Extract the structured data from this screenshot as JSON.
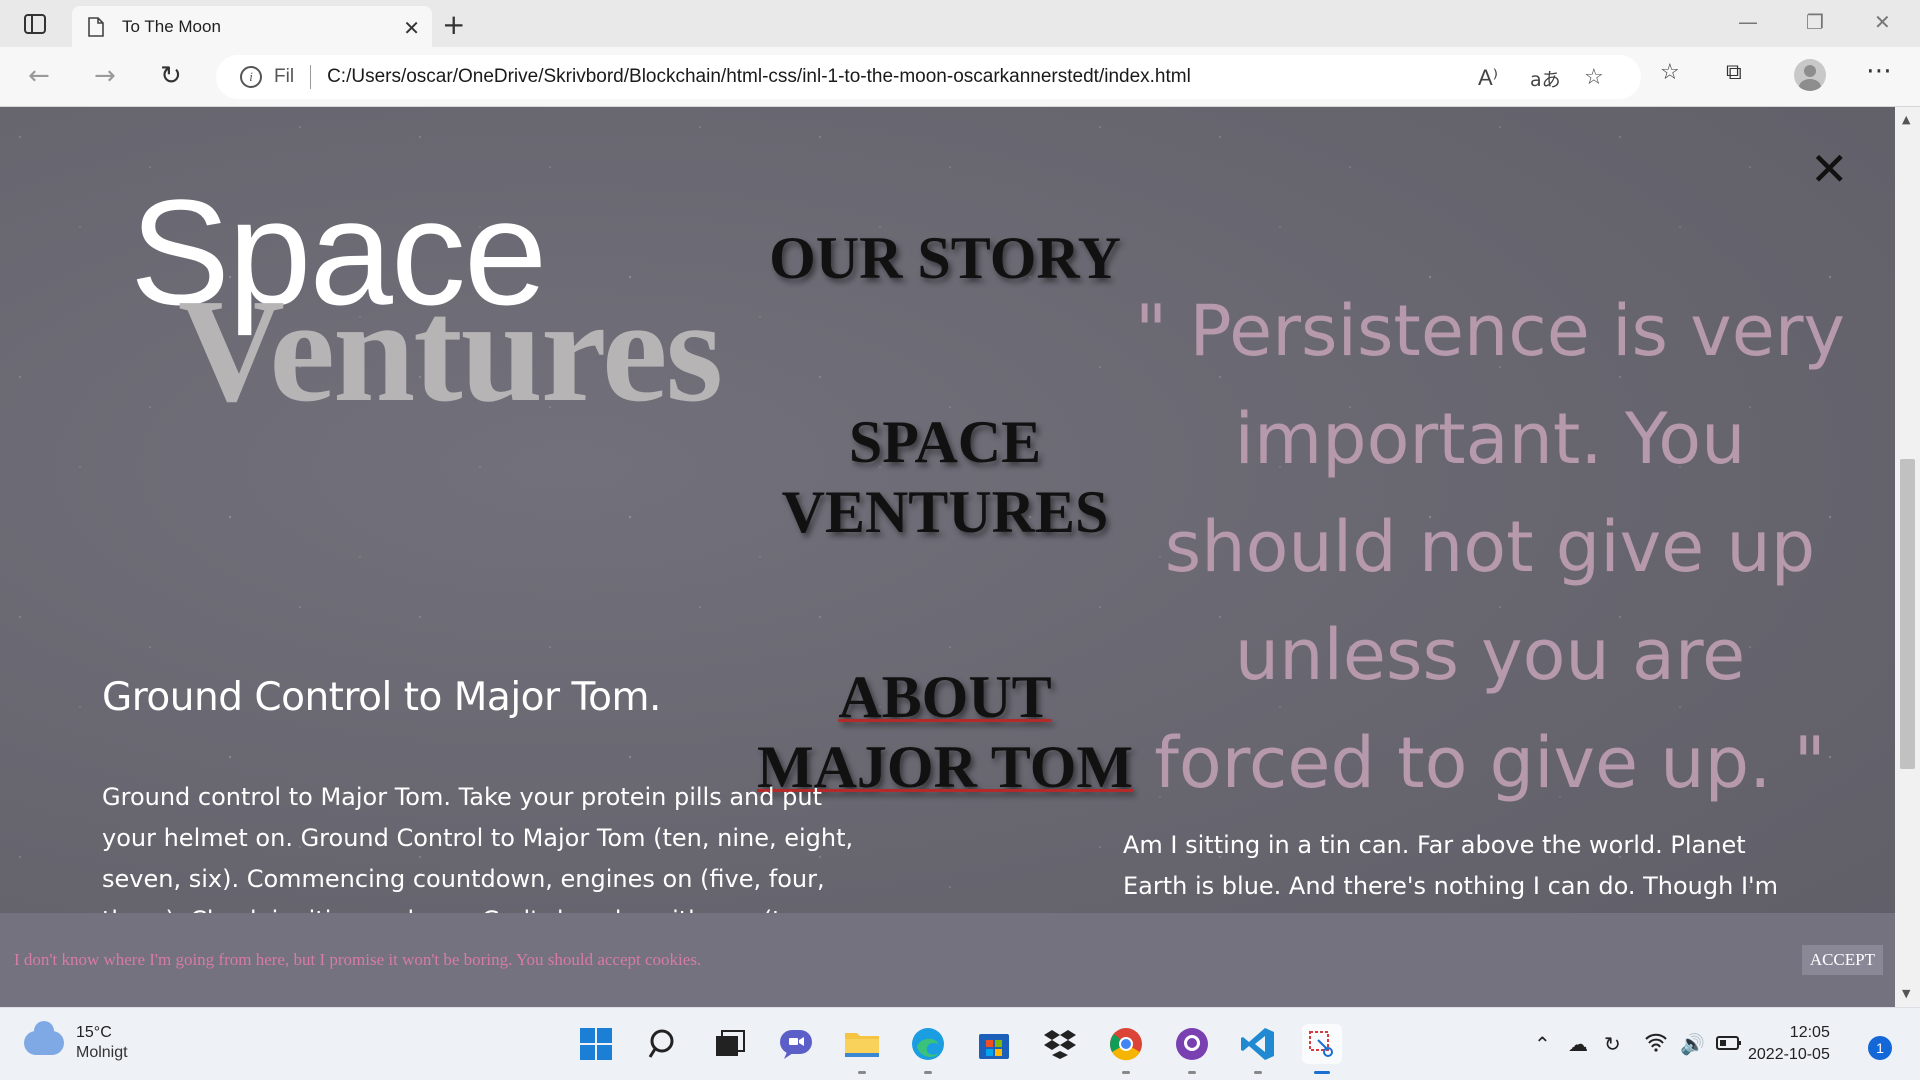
{
  "browser": {
    "tab_title": "To The Moon",
    "tab_close": "✕",
    "new_tab": "+",
    "url_scheme": "Fil",
    "url": "C:/Users/oscar/OneDrive/Skrivbord/Blockchain/html-css/inl-1-to-the-moon-oscarkannerstedt/index.html",
    "read_aloud_icon": "A⁾",
    "translate_icon": "aあ",
    "menu_dots": "⋯"
  },
  "page": {
    "logo_top": "Space",
    "logo_bottom": "Ventures",
    "close": "✕",
    "menu": [
      {
        "label": "OUR STORY"
      },
      {
        "label": "SPACE\nVENTURES"
      },
      {
        "label": "ABOUT\nMAJOR TOM"
      }
    ],
    "quote": "\" Persistence is very important. You should not give up unless you are forced to give up. \"",
    "heading": "Ground Control to Major Tom.",
    "body_left": "Ground control to Major Tom. Take your protein pills and put your helmet on. Ground Control to Major Tom (ten, nine, eight, seven, six). Commencing countdown, engines on (five, four, three). Check ignition and may God's love be with you (two,",
    "body_right": "Am I sitting in a tin can. Far above the world. Planet Earth is blue. And there's nothing I can do. Though I'm past one hundred thousand miles I'm feeling very still",
    "cookie_text": "I don't know where I'm going from here, but I promise it won't be boring. You should accept cookies.",
    "cookie_button": "ACCEPT",
    "accent_color": "#b22a2a",
    "quote_color": "#b699ab",
    "cookie_text_color": "#d77aa7"
  },
  "taskbar": {
    "weather_temp": "15°C",
    "weather_desc": "Molnigt",
    "time": "12:05",
    "date": "2022-10-05",
    "notifications": "1"
  }
}
